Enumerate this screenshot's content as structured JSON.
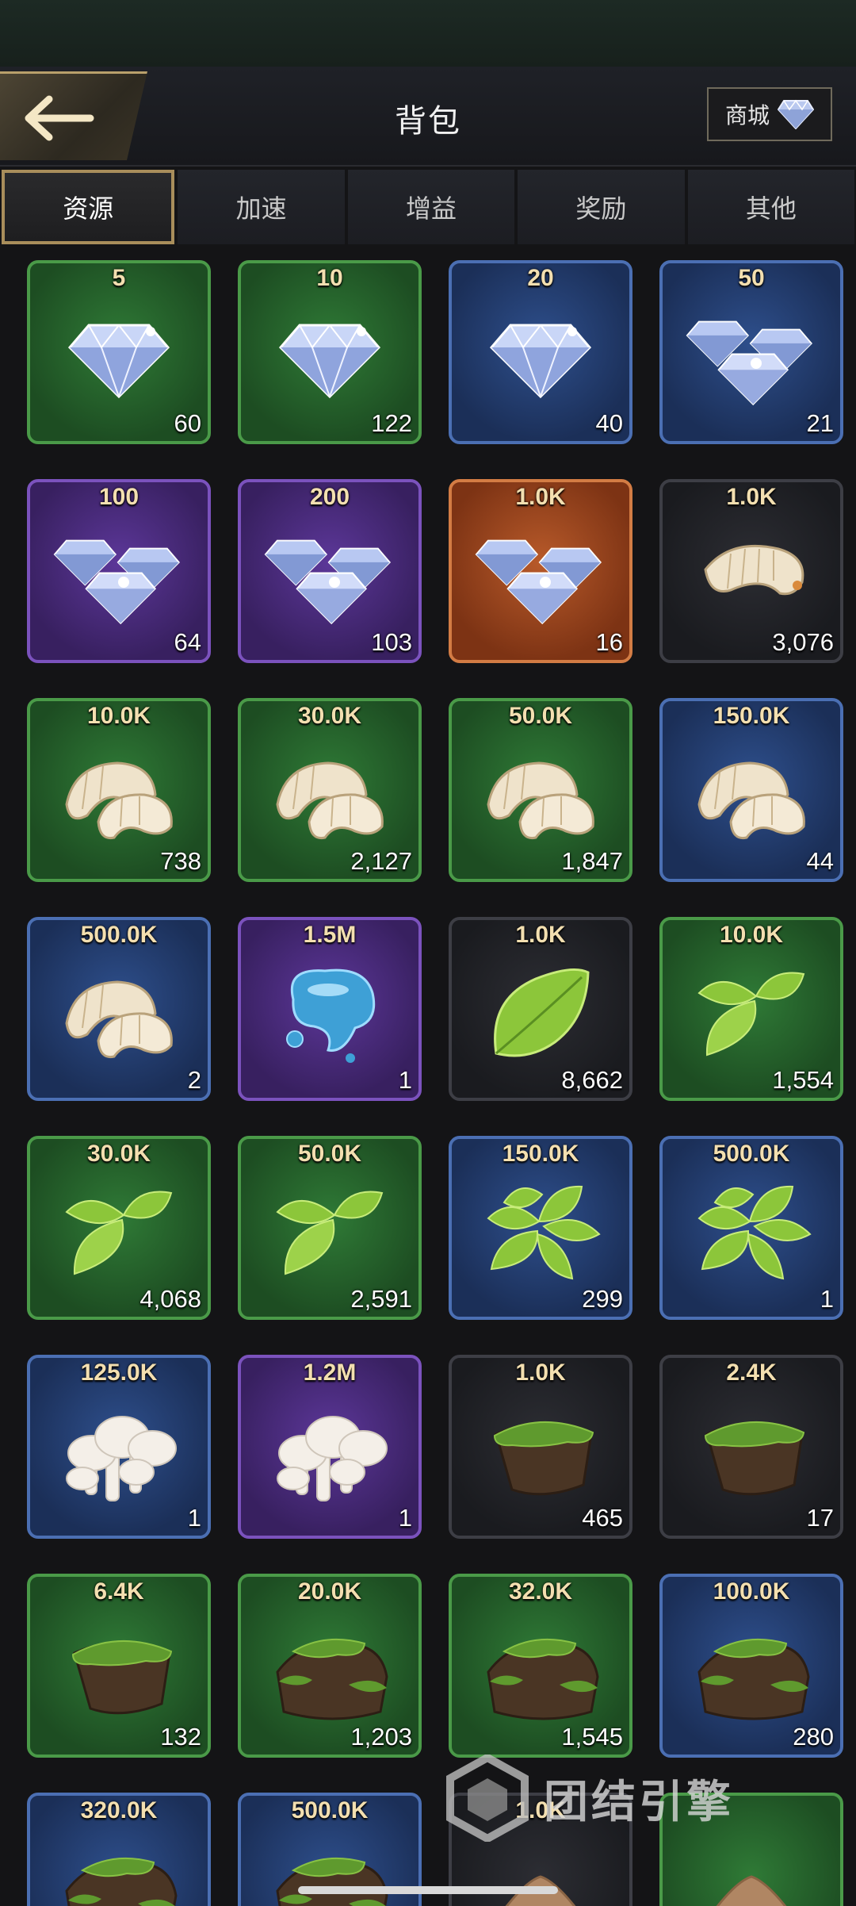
{
  "header": {
    "title": "背包",
    "shop_label": "商城"
  },
  "tabs": [
    {
      "label": "资源",
      "active": true
    },
    {
      "label": "加速",
      "active": false
    },
    {
      "label": "增益",
      "active": false
    },
    {
      "label": "奖励",
      "active": false
    },
    {
      "label": "其他",
      "active": false
    }
  ],
  "items": [
    {
      "amount": "5",
      "count": "60",
      "rarity": "green",
      "icon": "diamond"
    },
    {
      "amount": "10",
      "count": "122",
      "rarity": "green",
      "icon": "diamond"
    },
    {
      "amount": "20",
      "count": "40",
      "rarity": "blue",
      "icon": "diamond"
    },
    {
      "amount": "50",
      "count": "21",
      "rarity": "blue",
      "icon": "diamond-pile"
    },
    {
      "amount": "100",
      "count": "64",
      "rarity": "purple",
      "icon": "diamond-pile"
    },
    {
      "amount": "200",
      "count": "103",
      "rarity": "purple",
      "icon": "diamond-pile"
    },
    {
      "amount": "1.0K",
      "count": "16",
      "rarity": "orange",
      "icon": "diamond-pile"
    },
    {
      "amount": "1.0K",
      "count": "3,076",
      "rarity": "dark",
      "icon": "larva"
    },
    {
      "amount": "10.0K",
      "count": "738",
      "rarity": "green",
      "icon": "larva-pile"
    },
    {
      "amount": "30.0K",
      "count": "2,127",
      "rarity": "green",
      "icon": "larva-pile"
    },
    {
      "amount": "50.0K",
      "count": "1,847",
      "rarity": "green",
      "icon": "larva-pile"
    },
    {
      "amount": "150.0K",
      "count": "44",
      "rarity": "blue",
      "icon": "larva-pile"
    },
    {
      "amount": "500.0K",
      "count": "2",
      "rarity": "blue",
      "icon": "larva-pile"
    },
    {
      "amount": "1.5M",
      "count": "1",
      "rarity": "purple",
      "icon": "water"
    },
    {
      "amount": "1.0K",
      "count": "8,662",
      "rarity": "dark",
      "icon": "leaf"
    },
    {
      "amount": "10.0K",
      "count": "1,554",
      "rarity": "green",
      "icon": "leaves"
    },
    {
      "amount": "30.0K",
      "count": "4,068",
      "rarity": "green",
      "icon": "leaves"
    },
    {
      "amount": "50.0K",
      "count": "2,591",
      "rarity": "green",
      "icon": "leaves"
    },
    {
      "amount": "150.0K",
      "count": "299",
      "rarity": "blue",
      "icon": "leaf-bunch"
    },
    {
      "amount": "500.0K",
      "count": "1",
      "rarity": "blue",
      "icon": "leaf-bunch"
    },
    {
      "amount": "125.0K",
      "count": "1",
      "rarity": "blue",
      "icon": "mushroom"
    },
    {
      "amount": "1.2M",
      "count": "1",
      "rarity": "purple",
      "icon": "mushroom"
    },
    {
      "amount": "1.0K",
      "count": "465",
      "rarity": "dark",
      "icon": "soil"
    },
    {
      "amount": "2.4K",
      "count": "17",
      "rarity": "dark",
      "icon": "soil"
    },
    {
      "amount": "6.4K",
      "count": "132",
      "rarity": "green",
      "icon": "soil"
    },
    {
      "amount": "20.0K",
      "count": "1,203",
      "rarity": "green",
      "icon": "soil-pile"
    },
    {
      "amount": "32.0K",
      "count": "1,545",
      "rarity": "green",
      "icon": "soil-pile"
    },
    {
      "amount": "100.0K",
      "count": "280",
      "rarity": "blue",
      "icon": "soil-pile"
    },
    {
      "amount": "320.0K",
      "count": "",
      "rarity": "blue",
      "icon": "soil-pile"
    },
    {
      "amount": "500.0K",
      "count": "",
      "rarity": "blue",
      "icon": "soil-pile"
    },
    {
      "amount": "1.0K",
      "count": "",
      "rarity": "dark",
      "icon": "sand"
    },
    {
      "amount": "",
      "count": "",
      "rarity": "green",
      "icon": "sand"
    }
  ],
  "watermark": {
    "text": "团结引擎"
  },
  "colors": {
    "gold": "#f3dfb0",
    "tab_border": "#a98e5b"
  }
}
